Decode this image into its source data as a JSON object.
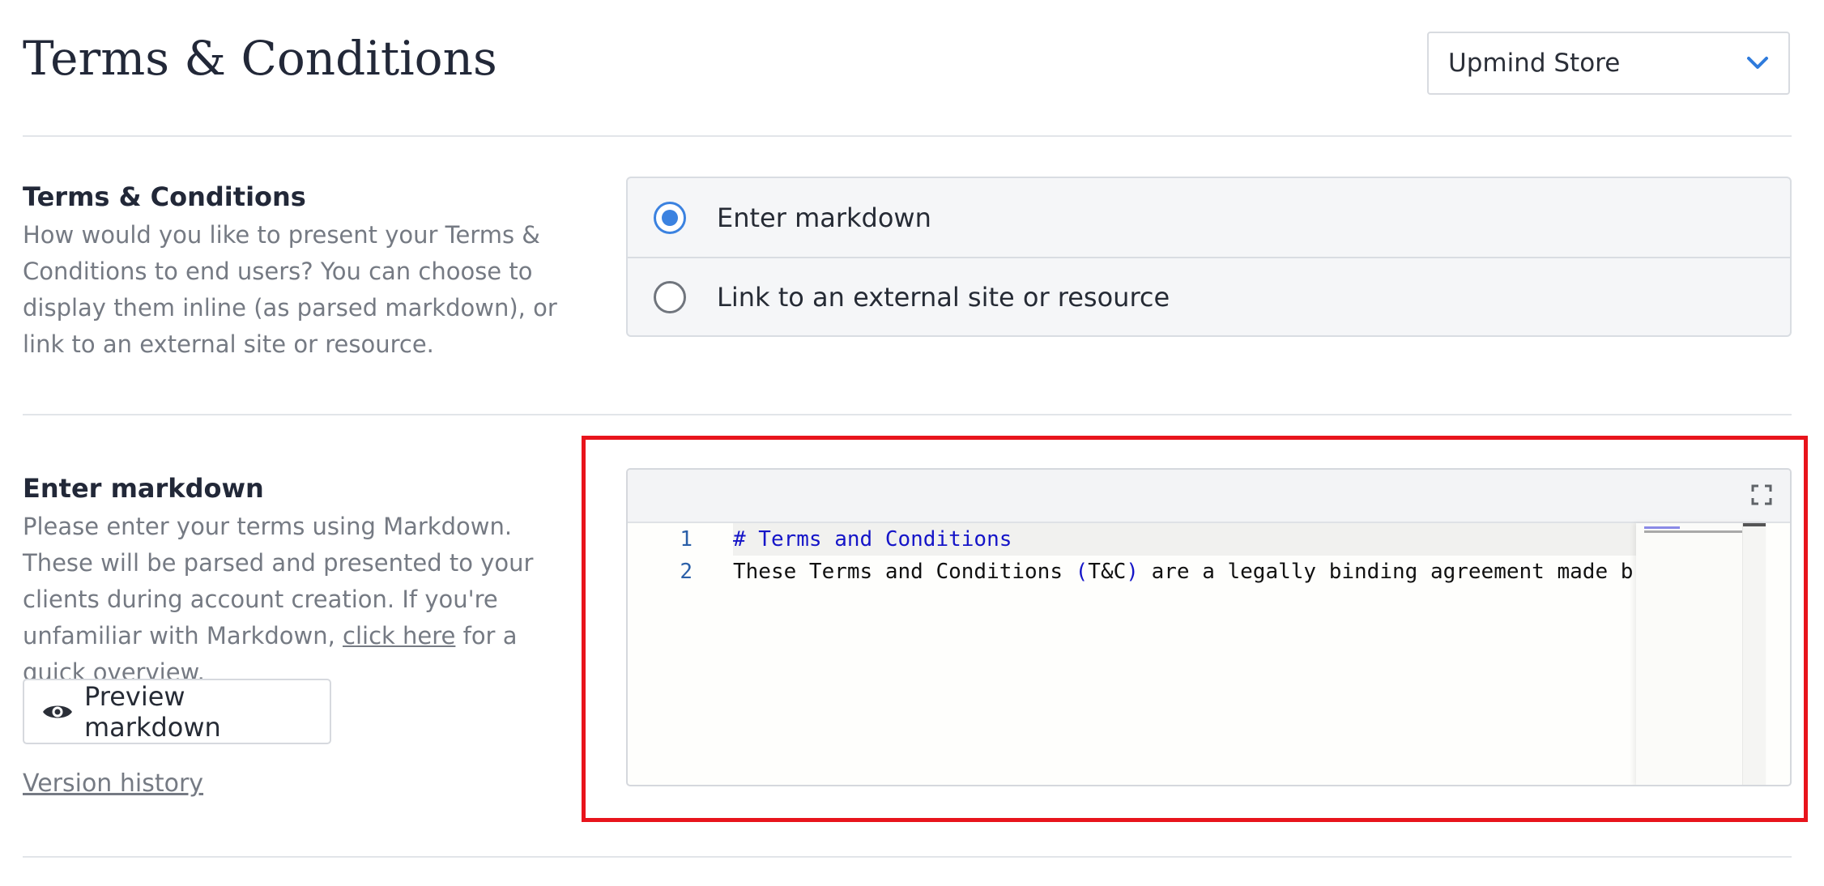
{
  "header": {
    "title": "Terms & Conditions",
    "store_select": {
      "value": "Upmind Store"
    }
  },
  "terms_section": {
    "title": "Terms & Conditions",
    "description": "How would you like to present your Terms & Conditions to end users? You can choose to display them inline (as parsed markdown), or link to an external site or resource.",
    "options": [
      {
        "label": "Enter markdown",
        "selected": true
      },
      {
        "label": "Link to an external site or resource",
        "selected": false
      }
    ]
  },
  "markdown_section": {
    "title": "Enter markdown",
    "description_before_link": "Please enter your terms using Markdown. These will be parsed and presented to your clients during account creation. If you're unfamiliar with Markdown, ",
    "link_text": "click here",
    "description_after_link": " for a quick overview.",
    "preview_button": "Preview markdown",
    "version_history": "Version history"
  },
  "editor": {
    "lines": [
      {
        "number": "1",
        "text": "# Terms and Conditions"
      },
      {
        "number": "2",
        "text_before": "These Terms and Conditions ",
        "paren_open": "(",
        "paren_inner": "T&C",
        "paren_close": ")",
        "text_after": " are a legally binding agreement made b"
      }
    ]
  },
  "colors": {
    "accent": "#3b82e0",
    "highlight_border": "#e8141c",
    "markdown_heading": "#1515c8"
  },
  "icons": [
    "chevron-down-icon",
    "eye-icon",
    "fullscreen-icon"
  ]
}
